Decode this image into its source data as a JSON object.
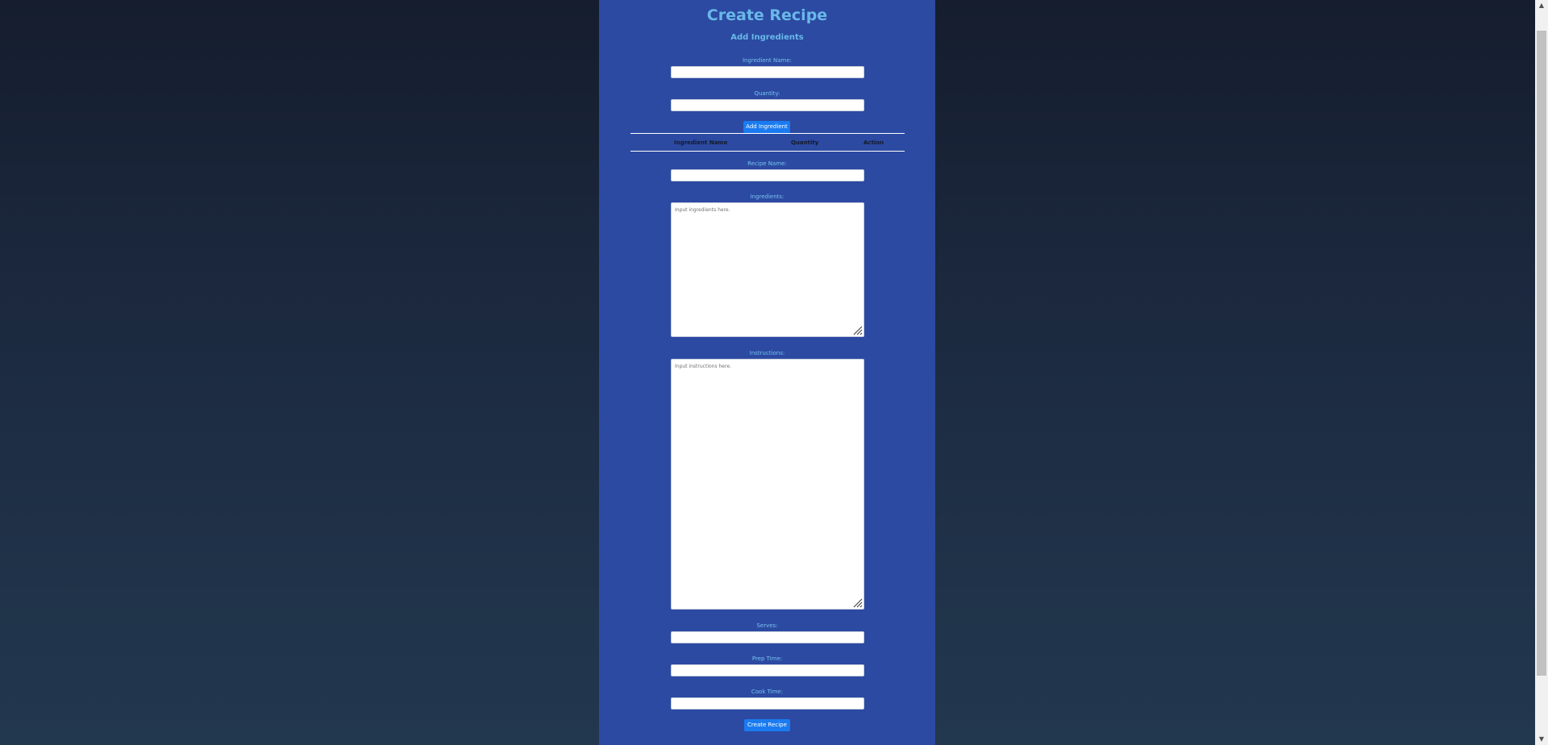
{
  "page": {
    "title": "Create Recipe",
    "subtitle": "Add Ingredients"
  },
  "ingredient_form": {
    "name_label": "Ingredient Name:",
    "name_value": "",
    "quantity_label": "Quantity:",
    "quantity_value": "",
    "add_button": "Add Ingredient"
  },
  "ingredients_table": {
    "headers": [
      "Ingredient Name",
      "Quantity",
      "Action"
    ],
    "rows": []
  },
  "recipe_form": {
    "recipe_name_label": "Recipe Name:",
    "recipe_name_value": "",
    "ingredients_label": "Ingredients:",
    "ingredients_placeholder": "Input ingredients here.",
    "instructions_label": "Instructions:",
    "instructions_placeholder": "Input instructions here.",
    "serves_label": "Serves:",
    "serves_value": "",
    "prep_time_label": "Prep Time:",
    "prep_time_value": "",
    "cook_time_label": "Cook Time:",
    "cook_time_value": "",
    "submit_button": "Create Recipe"
  },
  "icons": {
    "scroll_up": "chevron-up-icon",
    "scroll_down": "chevron-down-icon",
    "resize": "resize-grip-icon"
  },
  "colors": {
    "panel": "#2c4aa2",
    "accent_text": "#69b8e8",
    "button": "#1a7bf1"
  }
}
